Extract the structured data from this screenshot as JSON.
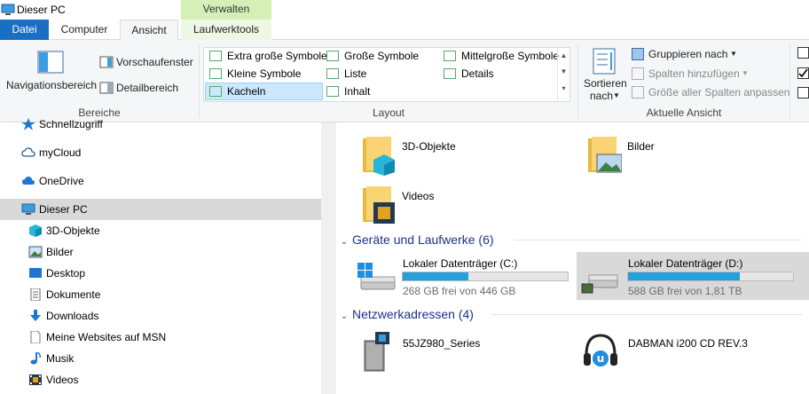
{
  "window": {
    "title": "Dieser PC",
    "context_tab_header": "Verwalten"
  },
  "tabs": {
    "file": "Datei",
    "computer": "Computer",
    "view": "Ansicht",
    "drive_tools": "Laufwerktools"
  },
  "ribbon": {
    "panes": {
      "nav_pane": "Navigationsbereich",
      "preview": "Vorschaufenster",
      "details": "Detailbereich",
      "group": "Bereiche"
    },
    "layout": {
      "items": {
        "xl": "Extra große Symbole",
        "large": "Große Symbole",
        "medium": "Mittelgroße Symbole",
        "small": "Kleine Symbole",
        "list": "Liste",
        "details": "Details",
        "tiles": "Kacheln",
        "content": "Inhalt"
      },
      "selected": "tiles",
      "group": "Layout"
    },
    "current_view": {
      "sort_by_l1": "Sortieren",
      "sort_by_l2": "nach",
      "group_by": "Gruppieren nach",
      "add_columns": "Spalten hinzufügen",
      "fit_columns": "Größe aller Spalten anpassen",
      "group": "Aktuelle Ansicht"
    },
    "checkboxes": [
      false,
      true,
      false
    ]
  },
  "nav": {
    "items": [
      {
        "label": "Schnellzugriff",
        "icon": "star-icon"
      },
      {
        "label": "myCloud",
        "icon": "cloud-outline-icon"
      },
      {
        "label": "OneDrive",
        "icon": "onedrive-cloud-icon"
      },
      {
        "label": "Dieser PC",
        "icon": "pc-icon"
      },
      {
        "label": "3D-Objekte",
        "icon": "cube-icon"
      },
      {
        "label": "Bilder",
        "icon": "pictures-icon"
      },
      {
        "label": "Desktop",
        "icon": "desktop-icon"
      },
      {
        "label": "Dokumente",
        "icon": "documents-icon"
      },
      {
        "label": "Downloads",
        "icon": "download-arrow-icon"
      },
      {
        "label": "Meine Websites auf MSN",
        "icon": "file-icon"
      },
      {
        "label": "Musik",
        "icon": "music-note-icon"
      },
      {
        "label": "Videos",
        "icon": "video-icon"
      }
    ]
  },
  "content": {
    "folders": [
      {
        "name": "3D-Objekte",
        "icon": "folder-3d-icon"
      },
      {
        "name": "Bilder",
        "icon": "folder-pictures-icon"
      },
      {
        "name": "Videos",
        "icon": "folder-videos-icon"
      }
    ],
    "devices_header": "Geräte und Laufwerke (6)",
    "drives": [
      {
        "name": "Lokaler Datenträger (C:)",
        "free": "268 GB frei von 446 GB",
        "used_fraction": 0.4,
        "icon": "windows-drive-icon"
      },
      {
        "name": "Lokaler Datenträger (D:)",
        "free": "588 GB frei von 1,81 TB",
        "used_fraction": 0.68,
        "icon": "drive-icon"
      }
    ],
    "network_header": "Netzwerkadressen (4)",
    "network": [
      {
        "name": "55JZ980_Series",
        "icon": "media-server-icon"
      },
      {
        "name": "DABMAN i200 CD REV.3",
        "icon": "headphones-icon"
      }
    ]
  },
  "colors": {
    "accent": "#1a6fc4",
    "bar_fill": "#26a0da",
    "selection": "#cce8ff",
    "section_header": "#1e3287"
  }
}
